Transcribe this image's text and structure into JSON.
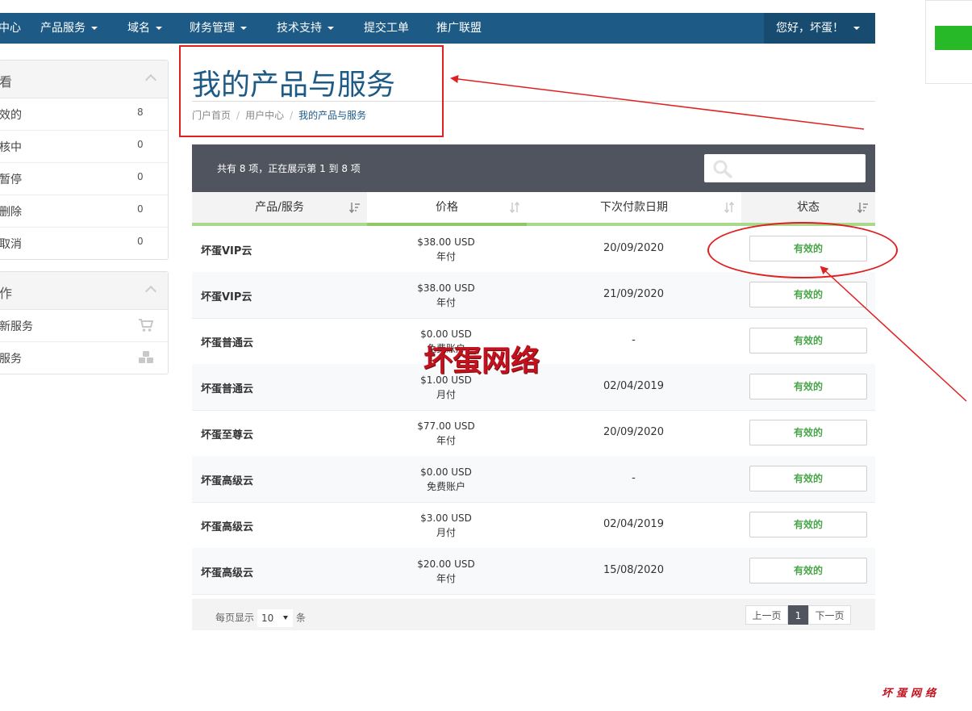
{
  "nav": {
    "items": [
      {
        "label": "中心",
        "dropdown": false
      },
      {
        "label": "产品服务",
        "dropdown": true
      },
      {
        "label": "域名",
        "dropdown": true
      },
      {
        "label": "财务管理",
        "dropdown": true
      },
      {
        "label": "技术支持",
        "dropdown": true
      },
      {
        "label": "提交工单",
        "dropdown": false
      },
      {
        "label": "推广联盟",
        "dropdown": false
      }
    ],
    "user_greeting": "您好，坏蛋！"
  },
  "sidebar": {
    "view_panel": {
      "title": "看",
      "items": [
        {
          "label": "效的",
          "count": "8"
        },
        {
          "label": "核中",
          "count": "0"
        },
        {
          "label": "暂停",
          "count": "0"
        },
        {
          "label": "删除",
          "count": "0"
        },
        {
          "label": "取消",
          "count": "0"
        }
      ]
    },
    "action_panel": {
      "title": "作",
      "items": [
        {
          "label": "新服务",
          "icon": "cart-icon"
        },
        {
          "label": "服务",
          "icon": "cubes-icon"
        }
      ]
    }
  },
  "page": {
    "title": "我的产品与服务",
    "breadcrumb": [
      "门户首页",
      "用户中心",
      "我的产品与服务"
    ]
  },
  "table": {
    "info": "共有 8 项，正在展示第 1 到 8 项",
    "search_placeholder": "",
    "columns": [
      "产品/服务",
      "价格",
      "下次付款日期",
      "状态"
    ],
    "rows": [
      {
        "name": "坏蛋VIP云",
        "price": "$38.00 USD",
        "cycle": "年付",
        "due": "20/09/2020",
        "status": "有效的"
      },
      {
        "name": "坏蛋VIP云",
        "price": "$38.00 USD",
        "cycle": "年付",
        "due": "21/09/2020",
        "status": "有效的"
      },
      {
        "name": "坏蛋普通云",
        "price": "$0.00 USD",
        "cycle": "免费账户",
        "due": "-",
        "status": "有效的"
      },
      {
        "name": "坏蛋普通云",
        "price": "$1.00 USD",
        "cycle": "月付",
        "due": "02/04/2019",
        "status": "有效的"
      },
      {
        "name": "坏蛋至尊云",
        "price": "$77.00 USD",
        "cycle": "年付",
        "due": "20/09/2020",
        "status": "有效的"
      },
      {
        "name": "坏蛋高级云",
        "price": "$0.00 USD",
        "cycle": "免费账户",
        "due": "-",
        "status": "有效的"
      },
      {
        "name": "坏蛋高级云",
        "price": "$3.00 USD",
        "cycle": "月付",
        "due": "02/04/2019",
        "status": "有效的"
      },
      {
        "name": "坏蛋高级云",
        "price": "$20.00 USD",
        "cycle": "年付",
        "due": "15/08/2020",
        "status": "有效的"
      }
    ],
    "footer": {
      "per_page_prefix": "每页显示",
      "per_page_value": "10",
      "per_page_suffix": "条",
      "prev": "上一页",
      "current_page": "1",
      "next": "下一页"
    }
  },
  "watermark": {
    "center": "坏蛋网络",
    "corner": "坏蛋网络"
  },
  "colors": {
    "nav_bg": "#1d5a86",
    "accent_green": "#48a548",
    "annotation_red": "#e02020",
    "toolbar_bg": "#50545f"
  }
}
